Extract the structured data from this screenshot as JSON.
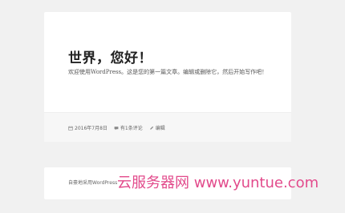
{
  "post": {
    "title": "世界，您好！",
    "body": "欢迎使用WordPress。这是您的第一篇文章。编辑或删除它，然后开始写作吧！",
    "meta": {
      "date": "2016年7月8日",
      "comments": "有1条评论",
      "edit": "编辑",
      "date_icon": "calendar-icon",
      "comments_icon": "comment-icon",
      "edit_icon": "pencil-icon"
    }
  },
  "footer": {
    "credit": "自豪地采用WordPress"
  },
  "watermark": {
    "text": "云服务器网 www.yuntue.com",
    "color": "#e24a8b"
  }
}
